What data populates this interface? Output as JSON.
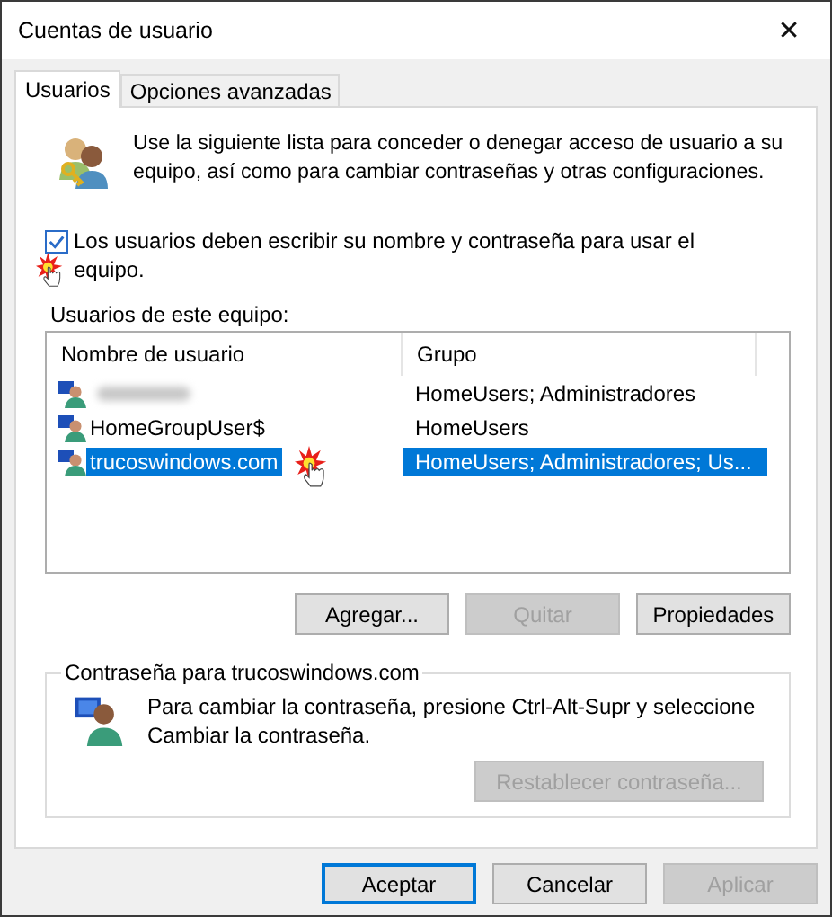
{
  "window": {
    "title": "Cuentas de usuario",
    "close_glyph": "✕"
  },
  "tabs": [
    {
      "label": "Usuarios",
      "selected": true
    },
    {
      "label": "Opciones avanzadas",
      "selected": false
    }
  ],
  "intro": "Use la siguiente lista para conceder o denegar acceso de usuario a su equipo, así como para cambiar contraseñas y otras configuraciones.",
  "require_login": {
    "label": "Los usuarios deben escribir su nombre y contraseña para usar el equipo.",
    "checked": true
  },
  "users_label": "Usuarios de este equipo:",
  "table": {
    "columns": [
      "Nombre de usuario",
      "Grupo"
    ],
    "rows": [
      {
        "kind": "blurred",
        "group": "HomeUsers; Administradores",
        "selected": false
      },
      {
        "kind": "text",
        "name": "HomeGroupUser$",
        "group": "HomeUsers",
        "selected": false
      },
      {
        "kind": "text",
        "name": "trucoswindows.com",
        "group": "HomeUsers; Administradores; Us...",
        "selected": true
      }
    ]
  },
  "list_buttons": [
    {
      "label": "Agregar...",
      "disabled": false
    },
    {
      "label": "Quitar",
      "disabled": true
    },
    {
      "label": "Propiedades",
      "disabled": false
    }
  ],
  "password_group": {
    "title": "Contraseña para trucoswindows.com",
    "text": "Para cambiar la contraseña, presione Ctrl-Alt-Supr y seleccione Cambiar la contraseña.",
    "button": {
      "label": "Restablecer contraseña...",
      "disabled": true
    }
  },
  "footer_buttons": [
    {
      "label": "Aceptar",
      "disabled": false,
      "default": true
    },
    {
      "label": "Cancelar",
      "disabled": false,
      "default": false
    },
    {
      "label": "Aplicar",
      "disabled": true,
      "default": false
    }
  ]
}
